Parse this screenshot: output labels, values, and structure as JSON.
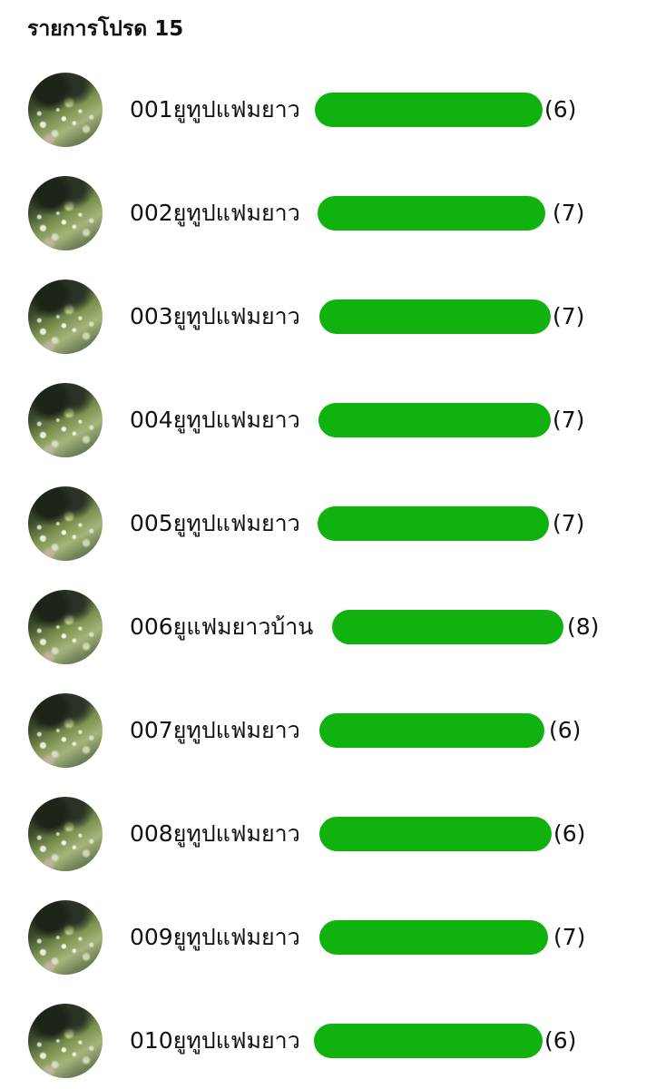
{
  "header": {
    "title": "รายการโปรด 15"
  },
  "favorites": [
    {
      "name": "001ยูทูปแฟมยาว",
      "count": "(6)"
    },
    {
      "name": "002ยูทูปแฟมยาว",
      "count": "(7)"
    },
    {
      "name": "003ยูทูปแฟมยาว",
      "count": "(7)"
    },
    {
      "name": "004ยูทูปแฟมยาว",
      "count": "(7)"
    },
    {
      "name": "005ยูทูปแฟมยาว",
      "count": "(7)"
    },
    {
      "name": "006ยูแฟมยาวบ้าน",
      "count": "(8)"
    },
    {
      "name": "007ยูทูปแฟมยาว",
      "count": "(6)"
    },
    {
      "name": "008ยูทูปแฟมยาว",
      "count": "(6)"
    },
    {
      "name": "009ยูทูปแฟมยาว",
      "count": "(7)"
    },
    {
      "name": "010ยูทูปแฟมยาว",
      "count": "(6)"
    }
  ],
  "colors": {
    "redaction_bar": "#0fb20f",
    "text": "#111111",
    "background": "#ffffff"
  },
  "icons": {
    "avatar": "group-avatar-photo"
  }
}
